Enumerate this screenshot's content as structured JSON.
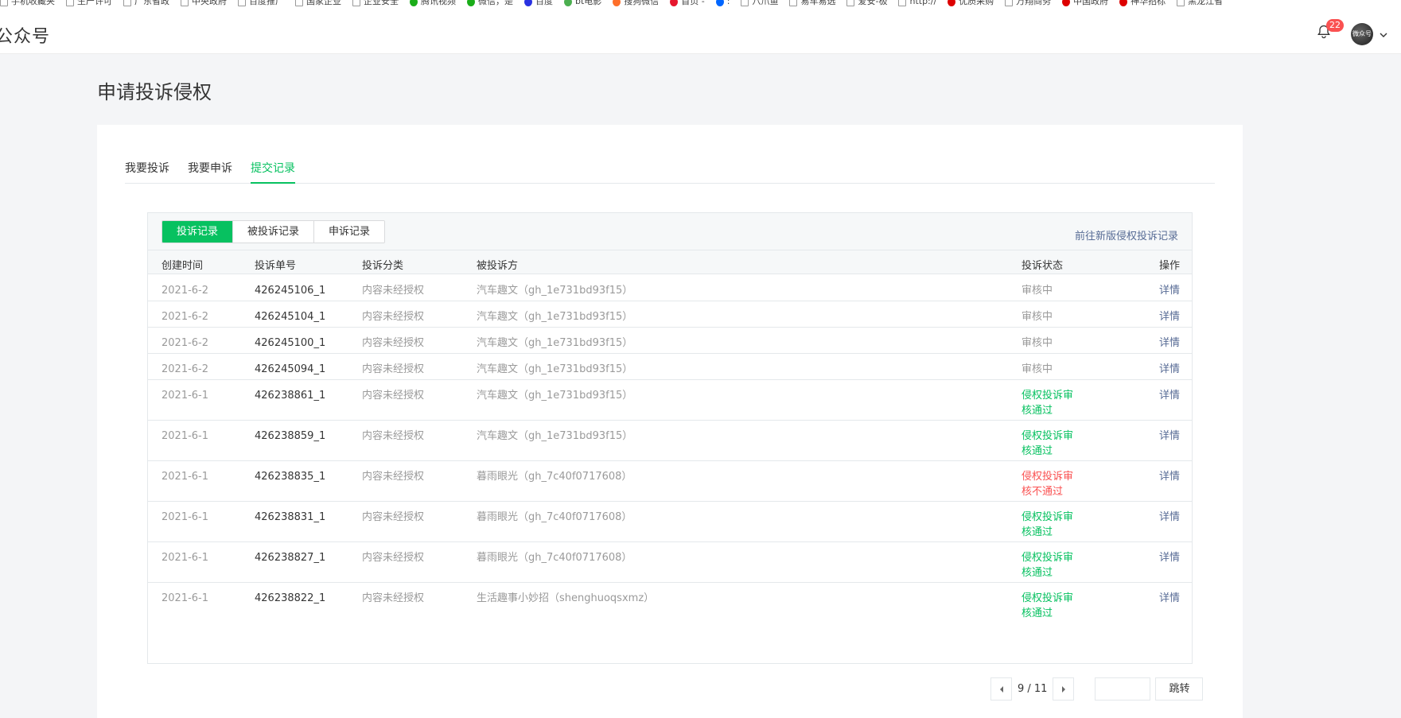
{
  "bookmarks": [
    {
      "label": "手机收藏夹",
      "icon": "folder-icon"
    },
    {
      "label": "生产许可",
      "icon": "page-icon"
    },
    {
      "label": "广东省政",
      "icon": "page-icon"
    },
    {
      "label": "中央政府",
      "icon": "page-icon"
    },
    {
      "label": "百度推广",
      "icon": "page-icon"
    },
    {
      "label": "国家企业",
      "icon": "page-icon"
    },
    {
      "label": "企业安全",
      "icon": "page-icon"
    },
    {
      "label": "腾讯视频",
      "icon": "tencent-video-icon",
      "color": "#1aad19"
    },
    {
      "label": "微信，是",
      "icon": "wechat-icon",
      "color": "#1aad19"
    },
    {
      "label": "百度",
      "icon": "baidu-icon",
      "color": "#2932e1"
    },
    {
      "label": "bt电影",
      "icon": "bt-icon",
      "color": "#4caf50"
    },
    {
      "label": "搜狗微信",
      "icon": "sogou-icon",
      "color": "#fe6f2a"
    },
    {
      "label": "首页 -",
      "icon": "weibo-icon",
      "color": "#e6162d"
    },
    {
      "label": ":",
      "icon": "zhihu-icon",
      "color": "#0066ff"
    },
    {
      "label": "八爪鱼",
      "icon": "page-icon"
    },
    {
      "label": "易车易选",
      "icon": "page-icon"
    },
    {
      "label": "爱安-极",
      "icon": "page-icon"
    },
    {
      "label": "http://",
      "icon": "page-icon"
    },
    {
      "label": "优质采购",
      "icon": "page-icon",
      "color": "#d00"
    },
    {
      "label": "万翔商务",
      "icon": "page-icon"
    },
    {
      "label": "中国政府",
      "icon": "gov-icon",
      "color": "#d00"
    },
    {
      "label": "神华招标",
      "icon": "page-icon",
      "color": "#d00"
    },
    {
      "label": "黑龙江省",
      "icon": "page-icon"
    }
  ],
  "header": {
    "brand": "公众号",
    "notification_count": "22",
    "avatar_text": "微众号"
  },
  "page": {
    "title": "申请投诉侵权"
  },
  "top_tabs": [
    {
      "label": "我要投诉",
      "active": false
    },
    {
      "label": "我要申诉",
      "active": false
    },
    {
      "label": "提交记录",
      "active": true
    }
  ],
  "panel": {
    "segments": [
      {
        "label": "投诉记录",
        "active": true
      },
      {
        "label": "被投诉记录",
        "active": false
      },
      {
        "label": "申诉记录",
        "active": false
      }
    ],
    "link": "前往新版侵权投诉记录"
  },
  "table": {
    "columns": [
      "创建时间",
      "投诉单号",
      "投诉分类",
      "被投诉方",
      "投诉状态",
      "操作"
    ],
    "rows": [
      {
        "date": "2021-6-2",
        "id": "426245106_1",
        "category": "内容未经授权",
        "target": "汽车趣文（gh_1e731bd93f15）",
        "status": "审核中",
        "status_type": "pending",
        "op": "详情"
      },
      {
        "date": "2021-6-2",
        "id": "426245104_1",
        "category": "内容未经授权",
        "target": "汽车趣文（gh_1e731bd93f15）",
        "status": "审核中",
        "status_type": "pending",
        "op": "详情"
      },
      {
        "date": "2021-6-2",
        "id": "426245100_1",
        "category": "内容未经授权",
        "target": "汽车趣文（gh_1e731bd93f15）",
        "status": "审核中",
        "status_type": "pending",
        "op": "详情"
      },
      {
        "date": "2021-6-2",
        "id": "426245094_1",
        "category": "内容未经授权",
        "target": "汽车趣文（gh_1e731bd93f15）",
        "status": "审核中",
        "status_type": "pending",
        "op": "详情"
      },
      {
        "date": "2021-6-1",
        "id": "426238861_1",
        "category": "内容未经授权",
        "target": "汽车趣文（gh_1e731bd93f15）",
        "status": "侵权投诉审核通过",
        "status_type": "pass",
        "op": "详情"
      },
      {
        "date": "2021-6-1",
        "id": "426238859_1",
        "category": "内容未经授权",
        "target": "汽车趣文（gh_1e731bd93f15）",
        "status": "侵权投诉审核通过",
        "status_type": "pass",
        "op": "详情"
      },
      {
        "date": "2021-6-1",
        "id": "426238835_1",
        "category": "内容未经授权",
        "target": "暮雨眼光（gh_7c40f0717608）",
        "status": "侵权投诉审核不通过",
        "status_type": "fail",
        "op": "详情"
      },
      {
        "date": "2021-6-1",
        "id": "426238831_1",
        "category": "内容未经授权",
        "target": "暮雨眼光（gh_7c40f0717608）",
        "status": "侵权投诉审核通过",
        "status_type": "pass",
        "op": "详情"
      },
      {
        "date": "2021-6-1",
        "id": "426238827_1",
        "category": "内容未经授权",
        "target": "暮雨眼光（gh_7c40f0717608）",
        "status": "侵权投诉审核通过",
        "status_type": "pass",
        "op": "详情"
      },
      {
        "date": "2021-6-1",
        "id": "426238822_1",
        "category": "内容未经授权",
        "target": "生活趣事小妙招（shenghuoqsxmz）",
        "status": "侵权投诉审核通过",
        "status_type": "pass",
        "op": "详情"
      }
    ]
  },
  "pagination": {
    "page_text": "9 / 11",
    "input_value": "",
    "jump_label": "跳转"
  },
  "colors": {
    "accent": "#07c160",
    "link": "#576b95",
    "danger": "#fa5151"
  }
}
